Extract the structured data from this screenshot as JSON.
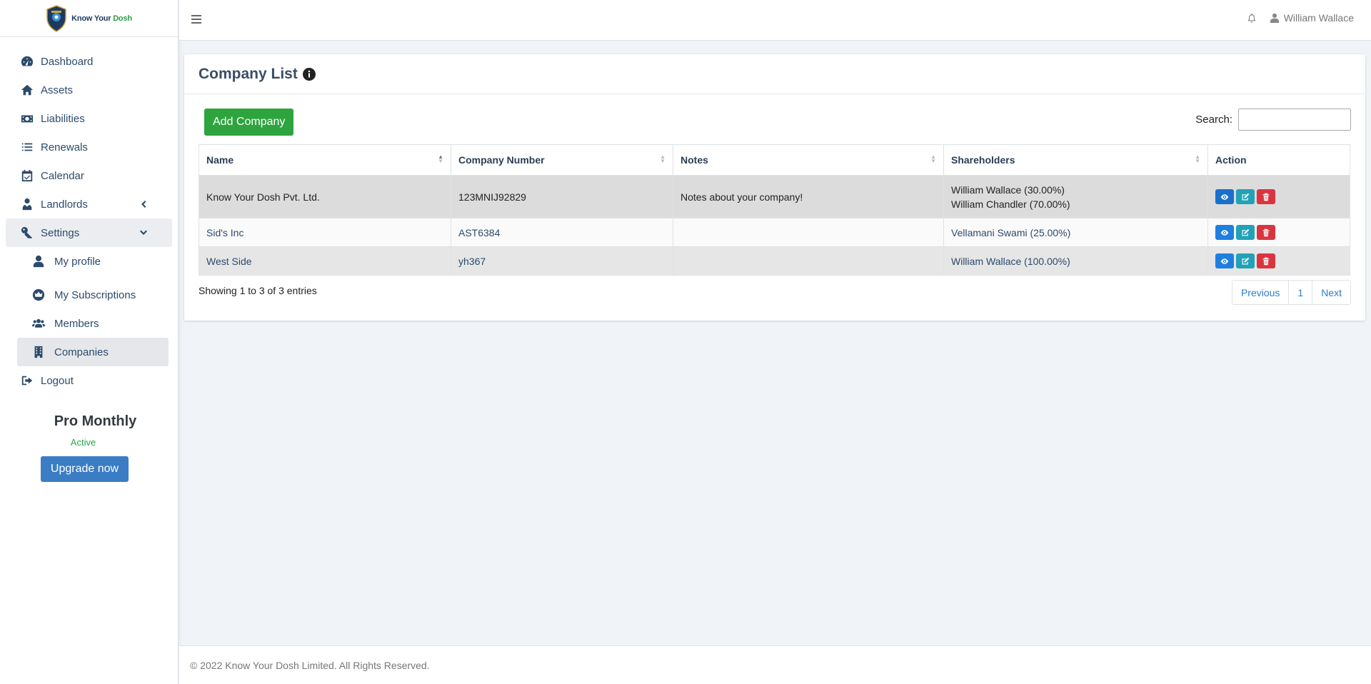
{
  "brand": {
    "name_part1": "Know Your ",
    "name_part2": "Dosh"
  },
  "sidebar": {
    "items": [
      {
        "label": "Dashboard",
        "icon": "dashboard-icon"
      },
      {
        "label": "Assets",
        "icon": "home-icon"
      },
      {
        "label": "Liabilities",
        "icon": "money-icon"
      },
      {
        "label": "Renewals",
        "icon": "list-icon"
      },
      {
        "label": "Calendar",
        "icon": "calendar-check-icon"
      },
      {
        "label": "Landlords",
        "icon": "user-tie-icon"
      },
      {
        "label": "Settings",
        "icon": "key-icon"
      }
    ],
    "sub_items": [
      {
        "label": "My profile",
        "icon": "user-icon"
      },
      {
        "label": "My Subscriptions",
        "icon": "crown-icon"
      },
      {
        "label": "Members",
        "icon": "users-icon"
      },
      {
        "label": "Companies",
        "icon": "building-icon"
      }
    ],
    "logout": "Logout",
    "plan": {
      "name": "Pro Monthly",
      "status": "Active",
      "upgrade_label": "Upgrade now"
    }
  },
  "topbar": {
    "user_name": "William Wallace"
  },
  "main": {
    "title": "Company List",
    "add_button": "Add Company",
    "search_label": "Search:",
    "search_value": "",
    "columns": [
      "Name",
      "Company Number",
      "Notes",
      "Shareholders",
      "Action"
    ],
    "rows": [
      {
        "name": "Know Your Dosh Pvt. Ltd.",
        "number": "123MNIJ92829",
        "notes": "Notes about your company!",
        "shareholders": [
          "William Wallace (30.00%)",
          "William Chandler (70.00%)"
        ]
      },
      {
        "name": "Sid's Inc",
        "number": "AST6384",
        "notes": "",
        "shareholders": [
          "Vellamani Swami (25.00%)"
        ]
      },
      {
        "name": "West Side",
        "number": "yh367",
        "notes": "",
        "shareholders": [
          "William Wallace (100.00%)"
        ]
      }
    ],
    "entries_info": "Showing 1 to 3 of 3 entries",
    "pagination": {
      "previous": "Previous",
      "page": "1",
      "next": "Next"
    }
  },
  "footer": {
    "text": "© 2022 Know Your Dosh Limited. All Rights Reserved."
  },
  "colors": {
    "accent_blue": "#3a7dc4",
    "add_green": "#2ea43f",
    "delete_red": "#d9353f",
    "edit_teal": "#22a2b8"
  }
}
